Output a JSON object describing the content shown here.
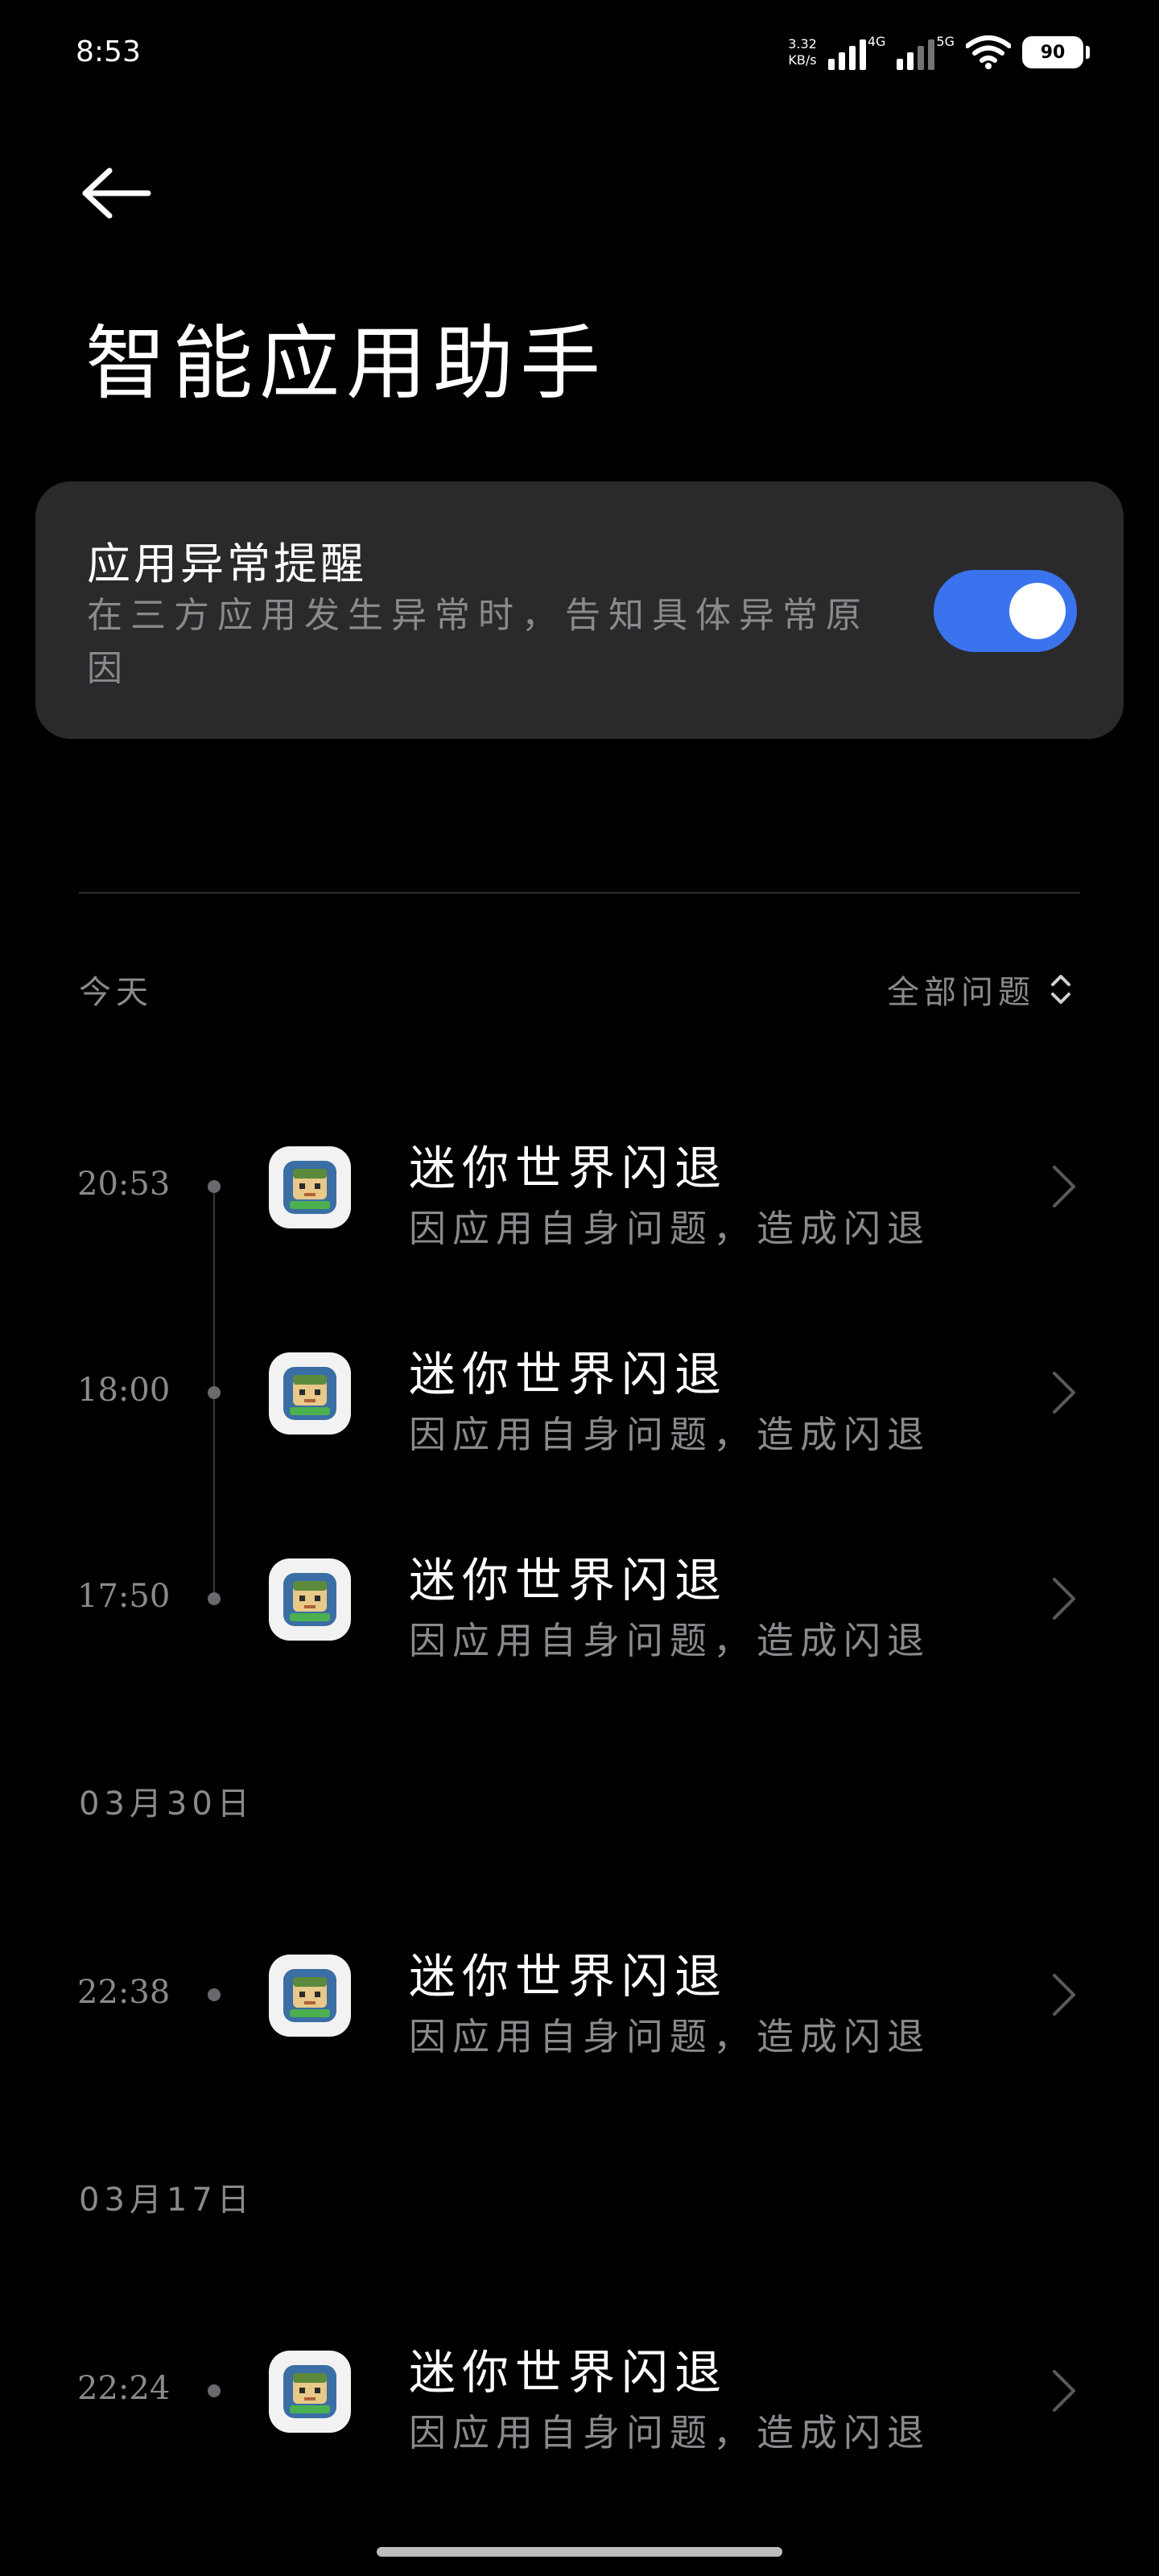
{
  "status_bar": {
    "time": "8:53",
    "net_speed_value": "3.32",
    "net_speed_unit": "KB/s",
    "network_gen_1": "4G",
    "network_gen_2": "5G",
    "battery": "90"
  },
  "header": {
    "title": "智能应用助手"
  },
  "toggle_card": {
    "title": "应用异常提醒",
    "description": "在三方应用发生异常时，告知具体异常原因",
    "enabled": true,
    "accent_color": "#3b73ee"
  },
  "filter": {
    "label": "全部问题"
  },
  "sections": [
    {
      "date": "今天",
      "items": [
        {
          "time": "20:53",
          "title": "迷你世界闪退",
          "desc": "因应用自身问题，造成闪退"
        },
        {
          "time": "18:00",
          "title": "迷你世界闪退",
          "desc": "因应用自身问题，造成闪退"
        },
        {
          "time": "17:50",
          "title": "迷你世界闪退",
          "desc": "因应用自身问题，造成闪退"
        }
      ]
    },
    {
      "date": "03月30日",
      "items": [
        {
          "time": "22:38",
          "title": "迷你世界闪退",
          "desc": "因应用自身问题，造成闪退"
        }
      ]
    },
    {
      "date": "03月17日",
      "items": [
        {
          "time": "22:24",
          "title": "迷你世界闪退",
          "desc": "因应用自身问题，造成闪退"
        }
      ]
    }
  ],
  "icons": {
    "back": "arrow-left-icon",
    "filter": "sort-up-down-icon",
    "item_chevron": "chevron-right-icon",
    "app": "mini-world-app-icon"
  }
}
